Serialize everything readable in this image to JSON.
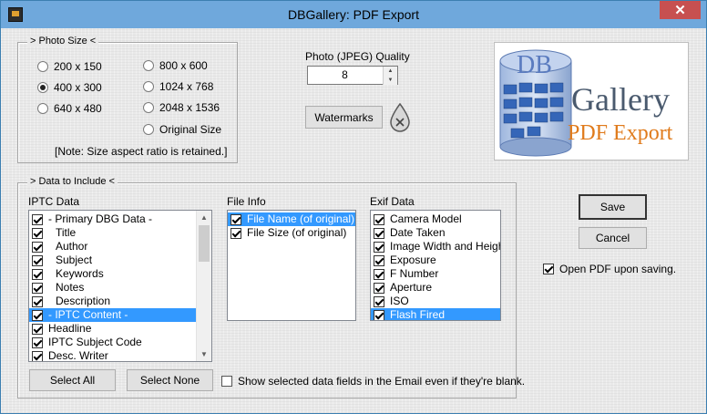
{
  "window": {
    "title": "DBGallery: PDF Export",
    "close_glyph": "✕"
  },
  "photo_size": {
    "legend": "> Photo Size <",
    "options": [
      "200 x 150",
      "400 x 300",
      "640 x 480",
      "800 x 600",
      "1024 x 768",
      "2048 x 1536",
      "Original Size"
    ],
    "selected": "400 x 300",
    "note": "[Note: Size aspect ratio is retained.]"
  },
  "quality": {
    "label": "Photo (JPEG) Quality",
    "value": "8"
  },
  "watermarks_label": "Watermarks",
  "logo": {
    "db": "DB",
    "gallery": "Gallery",
    "pdf": "PDF Export"
  },
  "data_include": {
    "legend": "> Data to Include <",
    "iptc": {
      "label": "IPTC Data",
      "items": [
        "- Primary DBG Data -",
        "Title",
        "Author",
        "Subject",
        "Keywords",
        "Notes",
        "Description",
        "- IPTC Content -",
        "Headline",
        "IPTC Subject Code",
        "Desc. Writer"
      ]
    },
    "file_info": {
      "label": "File Info",
      "items": [
        "File Name (of original)",
        "File Size (of original)"
      ]
    },
    "exif": {
      "label": "Exif Data",
      "items": [
        "Camera Model",
        "Date Taken",
        "Image Width and Height",
        "Exposure",
        "F Number",
        "Aperture",
        "ISO",
        "Flash Fired"
      ]
    },
    "select_all": "Select All",
    "select_none": "Select None",
    "show_blank_label": "Show selected data fields in the Email even if they're blank."
  },
  "save_label": "Save",
  "cancel_label": "Cancel",
  "open_pdf_label": "Open PDF upon saving.",
  "colors": {
    "titlebar": "#6fa8dc",
    "selection": "#3399ff",
    "close": "#c75050",
    "logo_gallery": "#4a5a6e",
    "logo_pdf": "#e07b1c"
  }
}
